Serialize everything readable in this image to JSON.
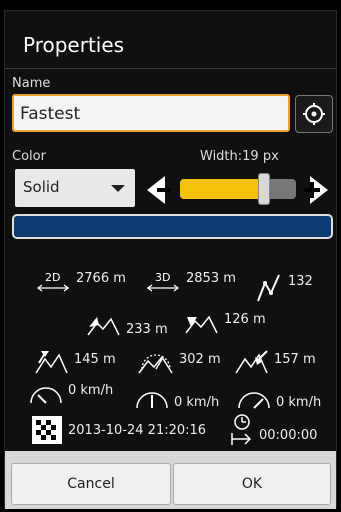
{
  "dialog": {
    "title": "Properties"
  },
  "name": {
    "label": "Name",
    "value": "Fastest"
  },
  "color": {
    "label": "Color",
    "selected": "Solid",
    "swatch": "#0c3a73"
  },
  "width": {
    "label": "Width:19 px",
    "level_fraction": 0.72
  },
  "stats": {
    "distance_2d": "2766 m",
    "distance_3d": "2853 m",
    "points": "132",
    "elevation_gain": "233 m",
    "elevation_loss": "126 m",
    "max_elevation": "145 m",
    "avg_elevation": "302 m",
    "min_elevation": "157 m",
    "speed_1": "0 km/h",
    "speed_2": "0 km/h",
    "speed_3": "0 km/h",
    "timestamp": "2013-10-24 21:20:16",
    "duration": "00:00:00"
  },
  "buttons": {
    "cancel": "Cancel",
    "ok": "OK"
  },
  "colors": {
    "accent": "#f0a030",
    "slider": "#f4c20d"
  }
}
